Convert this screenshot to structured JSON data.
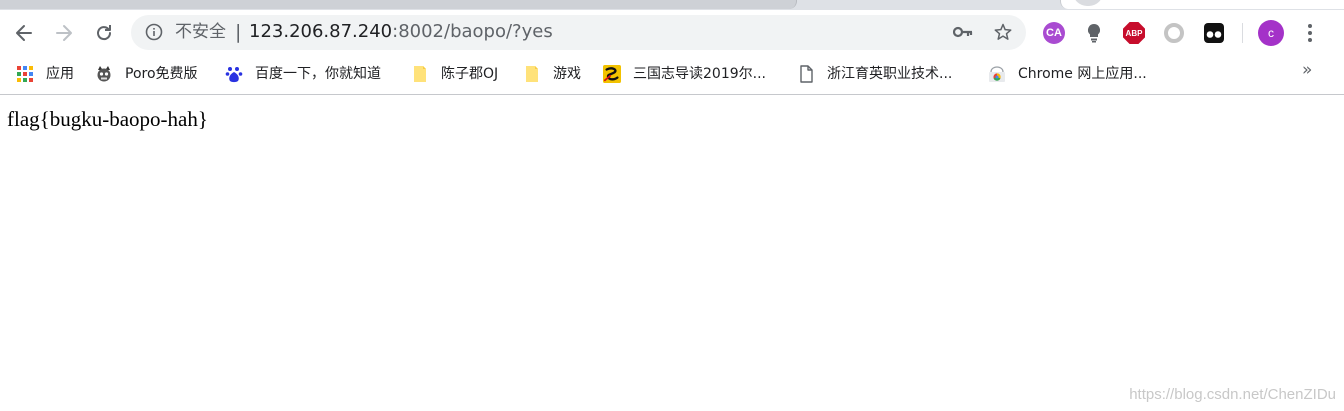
{
  "toolbar": {
    "security_label": "不安全",
    "separator": "|",
    "url_host": "123.206.87.240",
    "url_rest": ":8002/baopo/?yes",
    "icons": [
      "back-arrow-icon",
      "forward-arrow-icon",
      "reload-icon",
      "info-icon",
      "key-icon",
      "star-icon",
      "more-vert-icon"
    ],
    "extensions": [
      {
        "name": "ca-extension",
        "label": "CA",
        "color": "#a94bd1"
      },
      {
        "name": "lightbulb-extension",
        "label": ""
      },
      {
        "name": "adblock-plus-extension",
        "label": "ABP",
        "color": "#c70d2c"
      },
      {
        "name": "ring-extension",
        "label": ""
      },
      {
        "name": "tampermonkey-extension",
        "label": ""
      }
    ],
    "profile_initial": "c",
    "profile_color": "#a432c8"
  },
  "bookmarks": {
    "items": [
      {
        "label": "应用",
        "icon": "apps-grid-icon"
      },
      {
        "label": "Poro免费版",
        "icon": "poro-icon"
      },
      {
        "label": "百度一下，你就知道",
        "icon": "baidu-paw-icon"
      },
      {
        "label": "陈子郡OJ",
        "icon": "folder-icon"
      },
      {
        "label": "游戏",
        "icon": "folder-icon"
      },
      {
        "label": "三国志导读2019尔...",
        "icon": "sanguo-icon"
      },
      {
        "label": "浙江育英职业技术...",
        "icon": "page-icon"
      },
      {
        "label": "Chrome 网上应用...",
        "icon": "chrome-webstore-icon"
      }
    ],
    "overflow": "»"
  },
  "page": {
    "text": "flag{bugku-baopo-hah}"
  },
  "watermark": "https://blog.csdn.net/ChenZIDu"
}
